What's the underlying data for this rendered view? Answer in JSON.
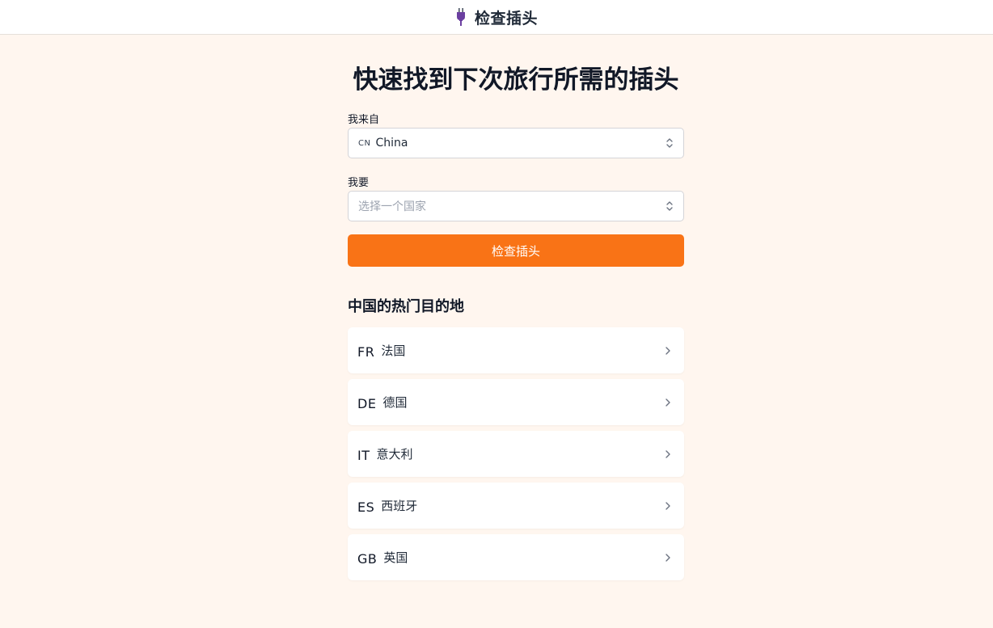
{
  "header": {
    "title": "检查插头",
    "icon": "plug-icon"
  },
  "main": {
    "hero_title": "快速找到下次旅行所需的插头",
    "from": {
      "label": "我来自",
      "code": "CN",
      "value": "China"
    },
    "to": {
      "label": "我要",
      "placeholder": "选择一个国家"
    },
    "check_button": "检查插头",
    "popular_title": "中国的热门目的地",
    "destinations": [
      {
        "code": "FR",
        "name": "法国"
      },
      {
        "code": "DE",
        "name": "德国"
      },
      {
        "code": "IT",
        "name": "意大利"
      },
      {
        "code": "ES",
        "name": "西班牙"
      },
      {
        "code": "GB",
        "name": "英国"
      }
    ]
  },
  "colors": {
    "background": "#fff6ef",
    "accent": "#f97316",
    "plug_icon": "#6b3fa0"
  }
}
